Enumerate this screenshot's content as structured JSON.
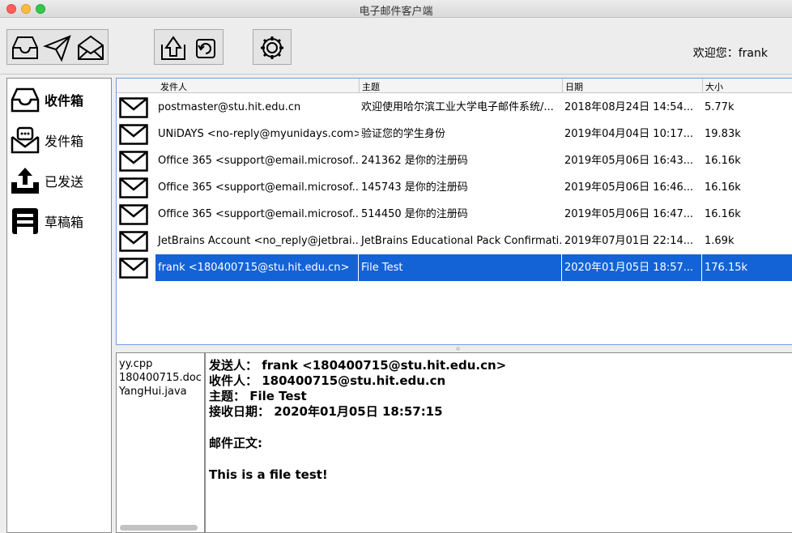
{
  "window": {
    "title": "电子邮件客户端"
  },
  "toolbar": {
    "welcome": "欢迎您：frank",
    "buttons": [
      {
        "icon": "inbox-icon"
      },
      {
        "icon": "send-icon"
      },
      {
        "icon": "envelope-open-icon"
      },
      {
        "icon": "reply-icon"
      },
      {
        "icon": "refresh-icon"
      },
      {
        "icon": "gear-icon"
      }
    ]
  },
  "sidebar": {
    "items": [
      {
        "label": "收件箱",
        "icon": "inbox-icon",
        "active": true
      },
      {
        "label": "发件箱",
        "icon": "outbox-icon",
        "active": false
      },
      {
        "label": "已发送",
        "icon": "upload-icon",
        "active": false
      },
      {
        "label": "草稿箱",
        "icon": "draft-icon",
        "active": false
      }
    ]
  },
  "maillist": {
    "columns": [
      "发件人",
      "主题",
      "日期",
      "大小"
    ],
    "rows": [
      {
        "sender": "postmaster@stu.hit.edu.cn",
        "subject": "欢迎使用哈尔滨工业大学电子邮件系统/...",
        "date": "2018年08月24日 14:54...",
        "size": "5.77k",
        "selected": false
      },
      {
        "sender": "UNiDAYS <no-reply@myunidays.com>",
        "subject": "验证您的学生身份",
        "date": "2019年04月04日 10:17...",
        "size": "19.83k",
        "selected": false
      },
      {
        "sender": "Office 365 <support@email.microsof...",
        "subject": "241362 是你的注册码",
        "date": "2019年05月06日 16:43...",
        "size": "16.16k",
        "selected": false
      },
      {
        "sender": "Office 365 <support@email.microsof...",
        "subject": "145743 是你的注册码",
        "date": "2019年05月06日 16:46...",
        "size": "16.16k",
        "selected": false
      },
      {
        "sender": "Office 365 <support@email.microsof...",
        "subject": "514450 是你的注册码",
        "date": "2019年05月06日 16:47...",
        "size": "16.16k",
        "selected": false
      },
      {
        "sender": "JetBrains Account <no_reply@jetbrai...",
        "subject": "JetBrains Educational Pack Confirmati...",
        "date": "2019年07月01日 22:14...",
        "size": "1.69k",
        "selected": false
      },
      {
        "sender": "frank <180400715@stu.hit.edu.cn>",
        "subject": "File Test",
        "date": "2020年01月05日 18:57...",
        "size": "176.15k",
        "selected": true
      }
    ]
  },
  "attachments": [
    "yy.cpp",
    "180400715.doc",
    "YangHui.java"
  ],
  "message": {
    "from": "发送人：   frank <180400715@stu.hit.edu.cn>",
    "to": "收件人：  180400715@stu.hit.edu.cn",
    "subject": "主题：   File Test",
    "date": "接收日期：   2020年01月05日 18:57:15",
    "body_label": "邮件正文:",
    "body": "This is a file test!"
  },
  "colors": {
    "selection": "#1363d6",
    "list_border": "#6d9fdc"
  }
}
